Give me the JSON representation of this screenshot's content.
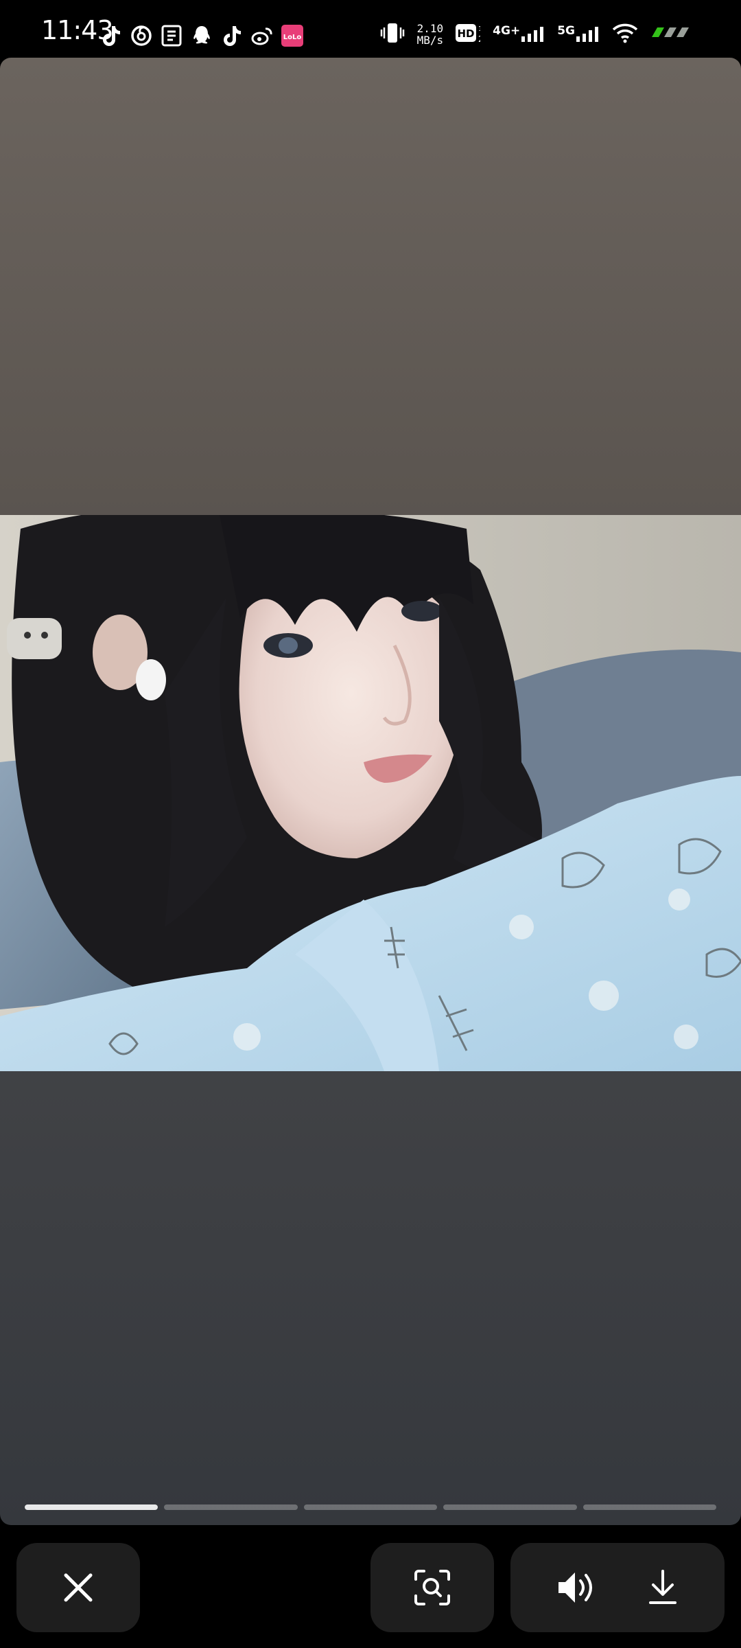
{
  "status_bar": {
    "time": "11:43",
    "notification_icons": [
      "tiktok-icon",
      "netease-music-icon",
      "app-icon",
      "qq-icon",
      "tiktok-icon",
      "weibo-icon",
      "lolo-app-icon"
    ],
    "notification_app_badge": "LoLo",
    "net_speed_value": "2.10",
    "net_speed_unit": "MB/s",
    "hd_label": "HD",
    "sim1_label": "4G+",
    "sim2_label": "5G",
    "colors": {
      "background": "#000000",
      "foreground": "#ffffff",
      "battery_green": "#34c21a"
    }
  },
  "viewer": {
    "background_top": "#6b645e",
    "background_bottom": "#35383d",
    "progress": {
      "segments": 5,
      "current_segment": 1,
      "current_fill": 1.0
    }
  },
  "controls": {
    "close_icon": "close-icon",
    "lens_icon": "visual-search-icon",
    "volume_icon": "speaker-volume-icon",
    "download_icon": "download-icon",
    "button_color": "#1e1e1e"
  }
}
